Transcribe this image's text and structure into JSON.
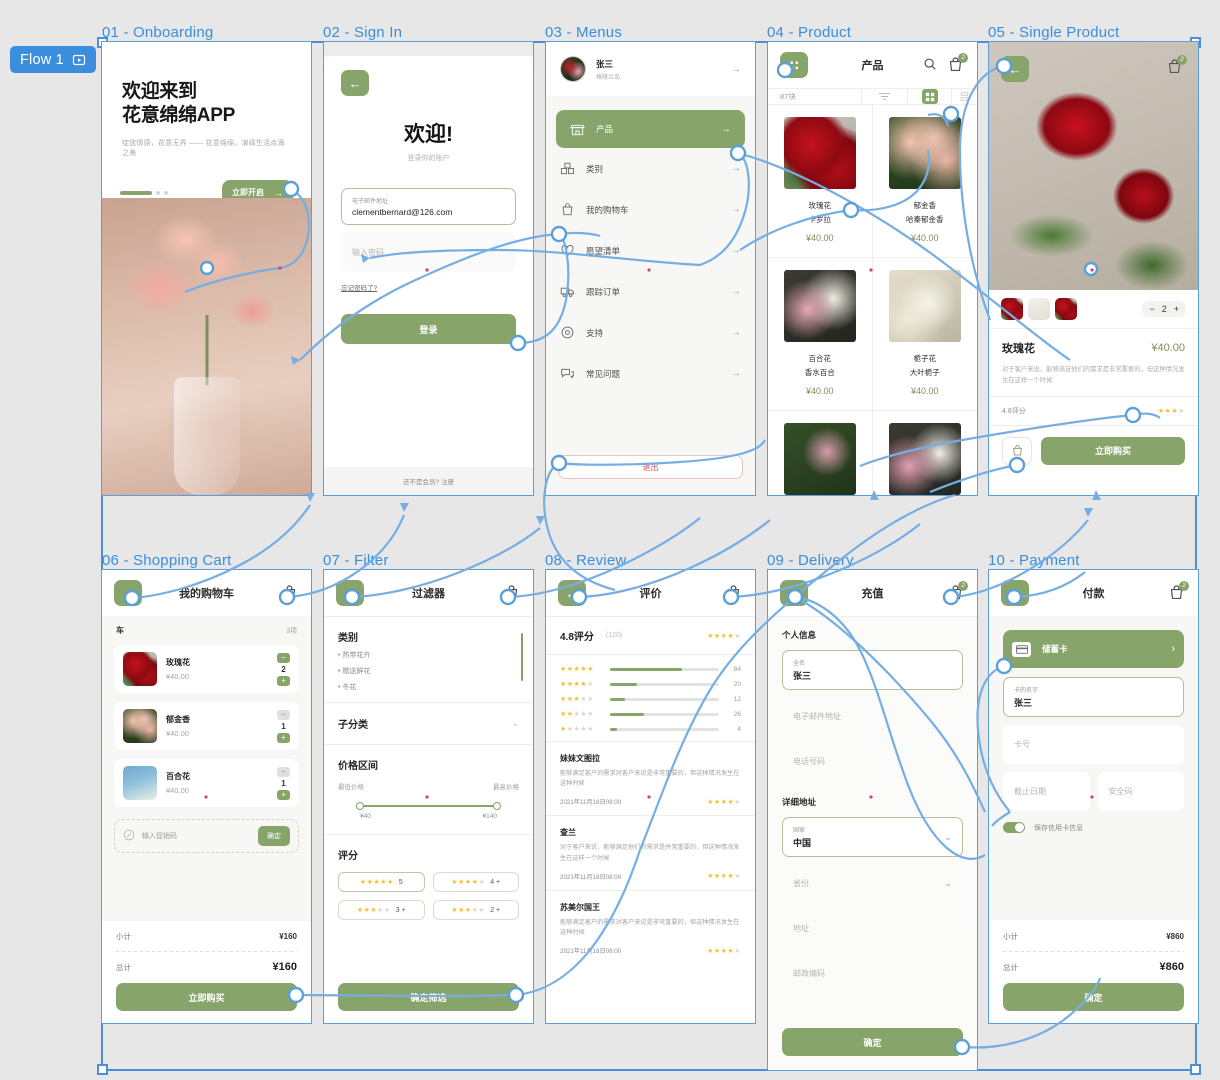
{
  "flow": {
    "badge_label": "Flow 1",
    "play_icon": "play-frame-icon"
  },
  "frames": [
    {
      "id": "01",
      "title": "01 - Onboarding"
    },
    {
      "id": "02",
      "title": "02 - Sign In"
    },
    {
      "id": "03",
      "title": "03 - Menus"
    },
    {
      "id": "04",
      "title": "04 - Product"
    },
    {
      "id": "05",
      "title": "05 - Single Product"
    },
    {
      "id": "06",
      "title": "06 - Shopping Cart"
    },
    {
      "id": "07",
      "title": "07 - Filter"
    },
    {
      "id": "08",
      "title": "08 - Review"
    },
    {
      "id": "09",
      "title": "09 - Delivery"
    },
    {
      "id": "10",
      "title": "10 - Payment"
    }
  ],
  "onboarding": {
    "title_line1": "欢迎来到",
    "title_line2": "花意绵绵APP",
    "subtitle": "绽放情感，花意无界 —— 花意绵绵，演绎生活点滴之美",
    "cta": "立即开启",
    "cta_arrow": "→"
  },
  "signin": {
    "heading": "欢迎!",
    "subheading": "登录你的账户",
    "email_label": "电子邮件地址",
    "email_value": "clementbernard@126.com",
    "password_placeholder": "输入密码",
    "forgot": "忘记密码了?",
    "submit": "登录",
    "footer": "还不是会员? 注册"
  },
  "menus": {
    "user_name": "张三",
    "user_sub": "格陵兰岛",
    "items": [
      {
        "label": "产品",
        "icon": "store-icon",
        "selected": true
      },
      {
        "label": "类别",
        "icon": "boxes-icon",
        "selected": false
      },
      {
        "label": "我的购物车",
        "icon": "bag-icon",
        "selected": false
      },
      {
        "label": "愿望清单",
        "icon": "heart-icon",
        "selected": false
      },
      {
        "label": "跟踪订单",
        "icon": "truck-icon",
        "selected": false
      },
      {
        "label": "支持",
        "icon": "headset-icon",
        "selected": false
      },
      {
        "label": "常见问题",
        "icon": "chat-icon",
        "selected": false
      }
    ],
    "logout": "退出",
    "arrow": "→"
  },
  "product": {
    "title": "产品",
    "count_label": "87块",
    "cart_badge": "2",
    "items": [
      {
        "name": "玫瑰花",
        "variety": "卡罗拉",
        "price": "¥40.00",
        "img": "ph-rose"
      },
      {
        "name": "郁金香",
        "variety": "哈秦郁金香",
        "price": "¥40.00",
        "img": "ph-tulip"
      },
      {
        "name": "百合花",
        "variety": "香水百合",
        "price": "¥40.00",
        "img": "ph-lily"
      },
      {
        "name": "栀子花",
        "variety": "大叶栀子",
        "price": "¥40.00",
        "img": "ph-gard"
      }
    ]
  },
  "single_product": {
    "cart_badge": "2",
    "quantity": "2",
    "minus": "−",
    "plus": "+",
    "name": "玫瑰花",
    "price": "¥40.00",
    "description": "对于客户来说，能够满足他们的需求是非常重要的，但这种情况发生在这样一个时候",
    "rating_label": "4.8评分",
    "rating_stars": 3,
    "buy_now": "立即购买",
    "bag_icon": "bag-icon"
  },
  "cart": {
    "title": "我的购物车",
    "section_label": "车",
    "count": "3项",
    "items": [
      {
        "name": "玫瑰花",
        "price": "¥40.00",
        "qty": "2",
        "img": "ph-rose",
        "minus_enabled": true
      },
      {
        "name": "郁金香",
        "price": "¥40.00",
        "qty": "1",
        "img": "ph-tulip",
        "minus_enabled": false
      },
      {
        "name": "百合花",
        "price": "¥40.00",
        "qty": "1",
        "img": "ph-gard",
        "minus_enabled": false
      }
    ],
    "promo_placeholder": "输入促销码",
    "promo_button": "确定",
    "subtotal_label": "小计",
    "subtotal_value": "¥160",
    "total_label": "总计",
    "total_value": "¥160",
    "checkout": "立即购买"
  },
  "filter": {
    "title": "过滤器",
    "category_heading": "类别",
    "categories": [
      "热带花卉",
      "赠送鲜花",
      "冬花"
    ],
    "subcategory_heading": "子分类",
    "price_heading": "价格区间",
    "price_min_label": "最低价格",
    "price_max_label": "最高价格",
    "price_min_value": "¥40",
    "price_max_value": "¥140",
    "rating_heading": "评分",
    "rating_chips": [
      {
        "stars": 5,
        "label": "5"
      },
      {
        "stars": 4,
        "label": "4 +"
      },
      {
        "stars": 3,
        "label": "3 +"
      },
      {
        "stars": 3,
        "label": "2 +"
      }
    ],
    "apply": "确定筛选"
  },
  "review": {
    "title": "评价",
    "score": "4.8评分",
    "count": "(120)",
    "score_stars": 4,
    "bars": [
      {
        "stars": 5,
        "value": 84,
        "pct": 66
      },
      {
        "stars": 4,
        "value": 20,
        "pct": 25
      },
      {
        "stars": 3,
        "value": 12,
        "pct": 14
      },
      {
        "stars": 2,
        "value": 26,
        "pct": 31
      },
      {
        "stars": 1,
        "value": 4,
        "pct": 6
      }
    ],
    "entries": [
      {
        "name": "妹妹文图拉",
        "text": "能够满足客户的需求对客户来说是非常重要的，但这种情况发生在这种时候",
        "date": "2021年11月18日08:00",
        "stars": 4
      },
      {
        "name": "查兰",
        "text": "对于客户来说，能够满足他们的需求是并常重要的，但这种情况发生在这样一个时候",
        "date": "2021年11月18日08:00",
        "stars": 4
      },
      {
        "name": "苏美尔国王",
        "text": "能够满足客户的需求对客户来说是非常重要的，但这种情况发生在这种时候",
        "date": "2021年11月18日08:00",
        "stars": 4
      }
    ]
  },
  "delivery": {
    "title": "充值",
    "personal_heading": "个人信息",
    "name_label": "全名",
    "name_value": "张三",
    "email_placeholder": "电子邮件地址",
    "phone_placeholder": "电话号码",
    "address_heading": "详细地址",
    "country_label": "国家",
    "country_value": "中国",
    "province_placeholder": "省份",
    "street_placeholder": "地址",
    "postal_placeholder": "邮政编码",
    "submit": "确定"
  },
  "payment": {
    "title": "付款",
    "method_label": "储蓄卡",
    "method_icon": "card-icon",
    "method_chevron": "›",
    "card_name_label": "卡的名字",
    "card_name_value": "张三",
    "card_number_placeholder": "卡号",
    "expiry_placeholder": "截止日期",
    "cvv_placeholder": "安全码",
    "save_card_label": "保存信用卡信息",
    "save_card_on": true,
    "subtotal_label": "小计",
    "subtotal_value": "¥860",
    "total_label": "总计",
    "total_value": "¥860",
    "submit": "确定"
  },
  "colors": {
    "accent_green": "#87a46a",
    "link_blue": "#5a9fd9",
    "badge_blue": "#3b8ede",
    "canvas": "#e7e7e7",
    "star_yellow": "#f2c230",
    "logout_red": "#d9534f"
  }
}
